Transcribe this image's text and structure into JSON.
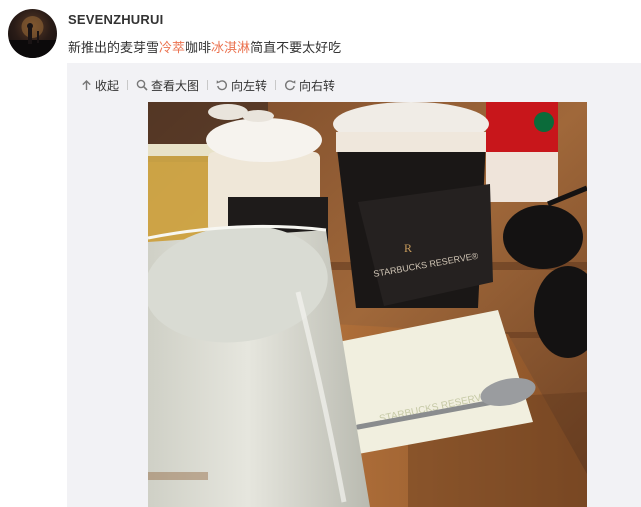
{
  "post": {
    "username": "SEVENZHURUI",
    "text_before": "新推出的麦芽雪",
    "tag1": "冷萃",
    "text_middle": "咖啡",
    "tag2": "冰淇淋",
    "text_after": "简直不要太好吃"
  },
  "toolbar": {
    "collapse_label": "收起",
    "view_large_label": "查看大图",
    "rotate_left_label": "向左转",
    "rotate_right_label": "向右转"
  },
  "photo": {
    "cup_logo_letter": "R",
    "cup_sleeve_text": "STARBUCKS RESERVE®",
    "napkin_text": "STARBUCKS RESERVE"
  },
  "colors": {
    "tag_color": "#eb7350",
    "panel_bg": "#f2f2f5"
  }
}
